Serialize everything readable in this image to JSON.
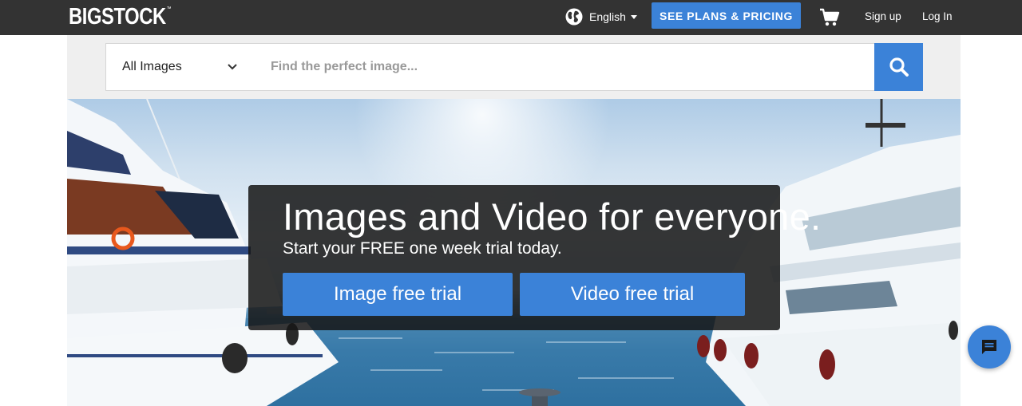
{
  "brand": {
    "name": "BIGSTOCK",
    "trademark": "™"
  },
  "header": {
    "language": "English",
    "plans_label": "SEE PLANS & PRICING",
    "signup_label": "Sign up",
    "login_label": "Log In"
  },
  "search": {
    "category": "All Images",
    "placeholder": "Find the perfect image..."
  },
  "hero": {
    "headline": "Images and Video for everyone.",
    "subline": "Start your FREE one week trial today.",
    "image_trial_label": "Image free trial",
    "video_trial_label": "Video free trial"
  },
  "icons": {
    "language": "globe-icon",
    "cart": "cart-icon",
    "dropdown": "chevron-down-icon",
    "search": "search-icon",
    "chat": "chat-icon"
  },
  "colors": {
    "topbar": "#333333",
    "accent": "#3b82d8",
    "overlay": "#161616"
  }
}
